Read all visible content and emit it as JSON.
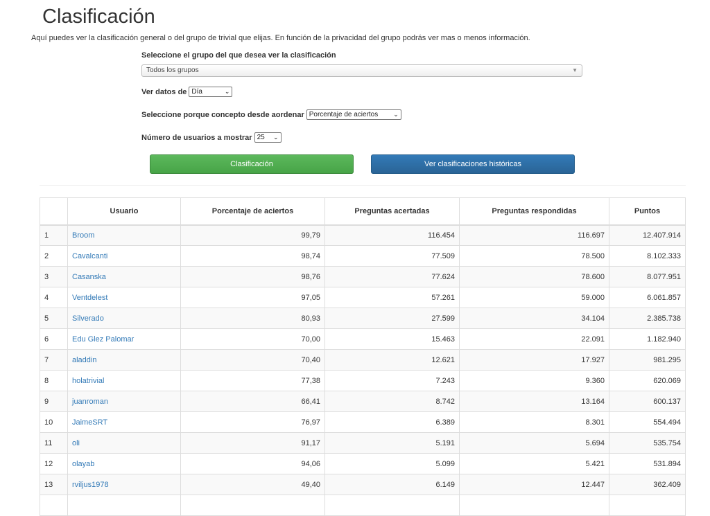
{
  "page": {
    "title": "Clasificación",
    "intro": "Aquí puedes ver la clasificación general o del grupo de trivial que elijas. En función de la privacidad del grupo podrás ver mas o menos información."
  },
  "filters": {
    "group_label": "Seleccione el grupo del que desea ver la clasificación",
    "group_value": "Todos los grupos",
    "period_label": "Ver datos de",
    "period_value": "Día",
    "order_label": "Seleccione porque concepto desde aordenar",
    "order_value": "Porcentaje de aciertos",
    "users_label": "Número de usuarios a mostrar",
    "users_value": "25"
  },
  "buttons": {
    "ranking": "Clasificación",
    "history": "Ver clasificaciones históricas"
  },
  "colors": {
    "green": "#5cb85c",
    "blue": "#337ab7",
    "link": "#337ab7"
  },
  "table": {
    "headers": [
      "",
      "Usuario",
      "Porcentaje de aciertos",
      "Preguntas acertadas",
      "Preguntas respondidas",
      "Puntos"
    ],
    "rows": [
      [
        "1",
        "Broom",
        "99,79",
        "116.454",
        "116.697",
        "12.407.914"
      ],
      [
        "2",
        "Cavalcanti",
        "98,74",
        "77.509",
        "78.500",
        "8.102.333"
      ],
      [
        "3",
        "Casanska",
        "98,76",
        "77.624",
        "78.600",
        "8.077.951"
      ],
      [
        "4",
        "Ventdelest",
        "97,05",
        "57.261",
        "59.000",
        "6.061.857"
      ],
      [
        "5",
        "Silverado",
        "80,93",
        "27.599",
        "34.104",
        "2.385.738"
      ],
      [
        "6",
        "Edu Glez Palomar",
        "70,00",
        "15.463",
        "22.091",
        "1.182.940"
      ],
      [
        "7",
        "aladdin",
        "70,40",
        "12.621",
        "17.927",
        "981.295"
      ],
      [
        "8",
        "holatrivial",
        "77,38",
        "7.243",
        "9.360",
        "620.069"
      ],
      [
        "9",
        "juanroman",
        "66,41",
        "8.742",
        "13.164",
        "600.137"
      ],
      [
        "10",
        "JaimeSRT",
        "76,97",
        "6.389",
        "8.301",
        "554.494"
      ],
      [
        "11",
        "oli",
        "91,17",
        "5.191",
        "5.694",
        "535.754"
      ],
      [
        "12",
        "olayab",
        "94,06",
        "5.099",
        "5.421",
        "531.894"
      ],
      [
        "13",
        "rviljus1978",
        "49,40",
        "6.149",
        "12.447",
        "362.409"
      ],
      [
        "",
        "",
        "",
        "",
        "",
        ""
      ]
    ]
  }
}
